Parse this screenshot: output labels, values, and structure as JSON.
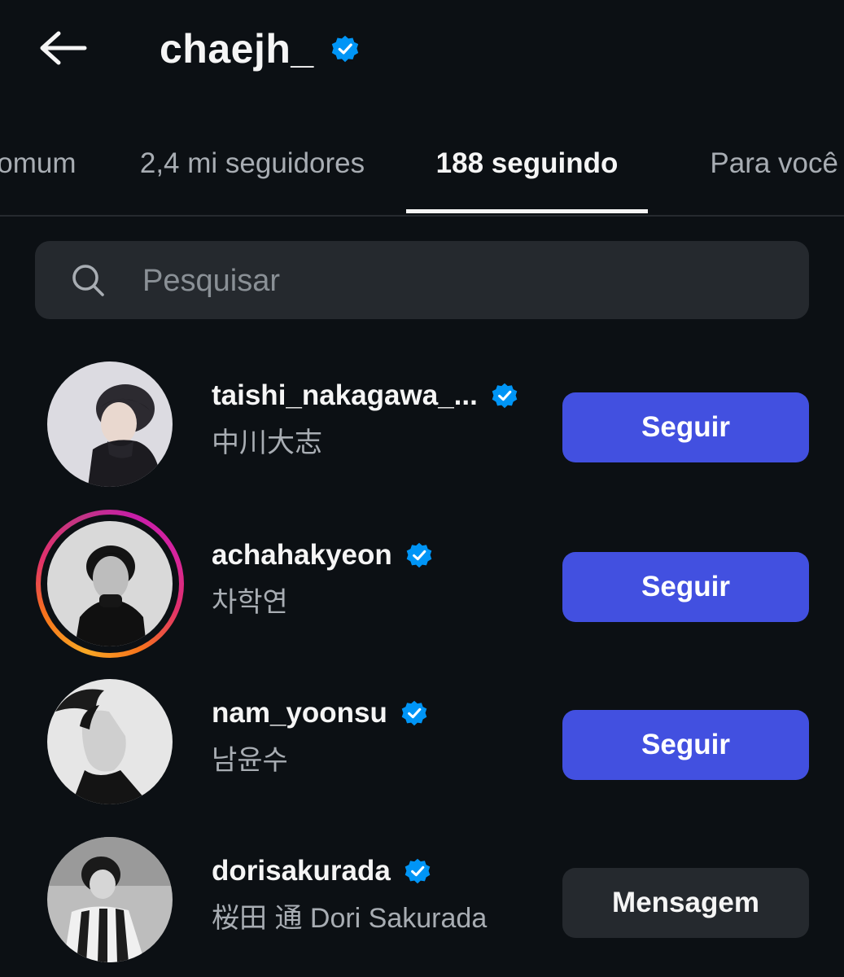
{
  "header": {
    "title": "chaejh_",
    "back_icon": "arrow-left-icon",
    "verified_icon": "verified-badge-icon"
  },
  "tabs": [
    {
      "label": "Em comum"
    },
    {
      "label": "2,4 mi seguidores"
    },
    {
      "label": "188 seguindo",
      "active": true
    },
    {
      "label": "Para você"
    }
  ],
  "search": {
    "placeholder": "Pesquisar",
    "value": "",
    "icon": "search-icon"
  },
  "users": [
    {
      "username": "taishi_nakagawa_...",
      "fullname": "中川大志",
      "verified": true,
      "story": false,
      "action": "Seguir"
    },
    {
      "username": "achahakyeon",
      "fullname": "차학연",
      "verified": true,
      "story": true,
      "action": "Seguir"
    },
    {
      "username": "nam_yoonsu",
      "fullname": "남윤수",
      "verified": true,
      "story": false,
      "action": "Seguir"
    },
    {
      "username": "dorisakurada",
      "fullname": "桜田 通 Dori Sakurada",
      "verified": true,
      "story": false,
      "action": "Mensagem"
    }
  ],
  "colors": {
    "background": "#0c1014",
    "primary_button": "#4250e0",
    "secondary_button": "#25292e",
    "verified": "#0095f6",
    "text_primary": "#f5f5f5",
    "text_secondary": "#a8adb3"
  }
}
